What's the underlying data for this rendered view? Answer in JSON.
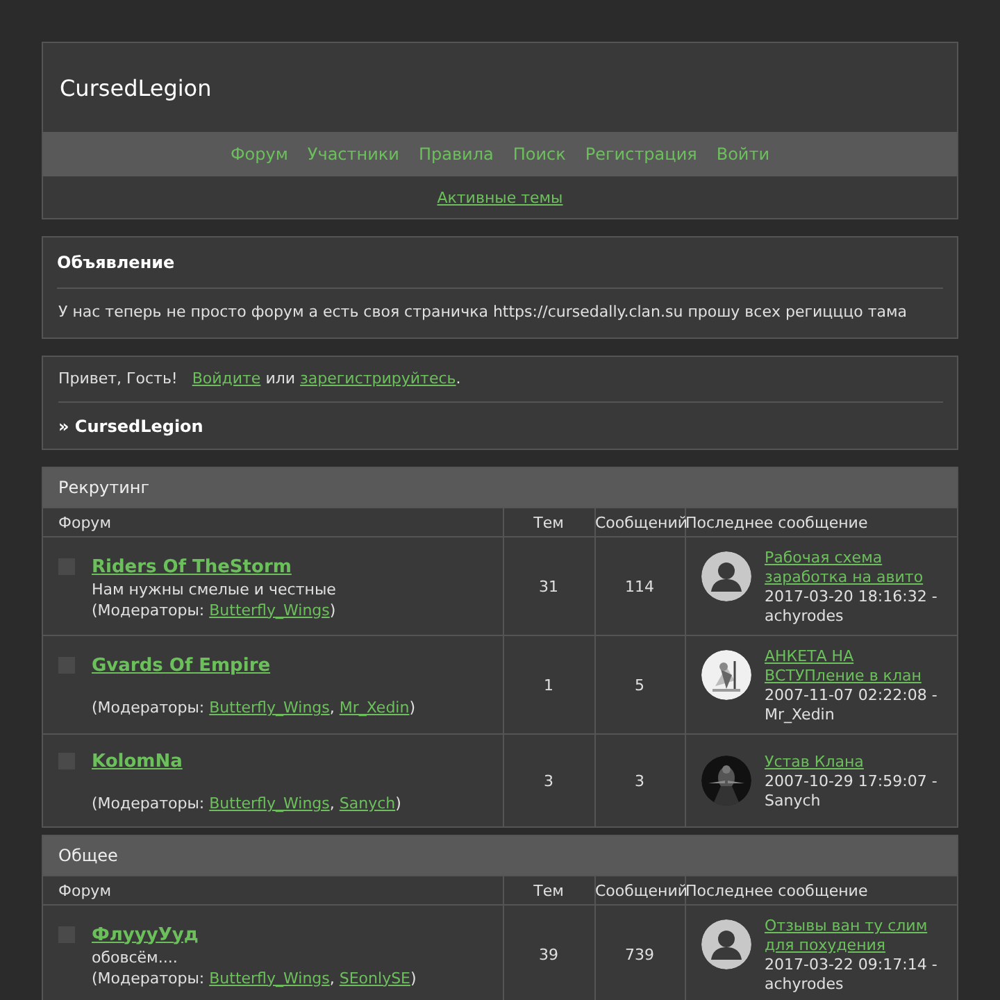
{
  "header": {
    "title": "CursedLegion",
    "nav": [
      "Форум",
      "Участники",
      "Правила",
      "Поиск",
      "Регистрация",
      "Войти"
    ],
    "active_topics_link": "Активные темы"
  },
  "announcement": {
    "title": "Объявление",
    "text": "У нас теперь не просто форум а есть своя страничка https://cursedally.clan.su прошу всех регицццо тама"
  },
  "welcome": {
    "greeting": "Привет, Гость!",
    "login_link": "Войдите",
    "conjunction": "или",
    "register_link": "зарегистрируйтесь",
    "end": ".",
    "breadcrumb": "» CursedLegion"
  },
  "categories": [
    {
      "title": "Рекрутинг",
      "columns": [
        "Форум",
        "Тем",
        "Сообщений",
        "Последнее сообщение"
      ],
      "forums": [
        {
          "name": "Riders Of TheStorm",
          "description": "Нам нужны смелые и честные",
          "moderators_prefix": "(Модераторы: ",
          "moderators": [
            "Butterfly_Wings"
          ],
          "moderators_suffix": ")",
          "topics": "31",
          "posts": "114",
          "last_post": {
            "avatar": {
              "kind": "default"
            },
            "topic": "Рабочая схема заработка на авито",
            "date": "2017-03-20 18:16:32 -",
            "author": "achyrodes"
          }
        },
        {
          "name": "Gvards Of Empire",
          "moderators_prefix": "(Модераторы: ",
          "moderators": [
            "Butterfly_Wings",
            "Mr_Xedin"
          ],
          "separator": ", ",
          "moderators_suffix": ")",
          "topics": "1",
          "posts": "5",
          "last_post": {
            "topic": "АНКЕТА НА ВСТУПление в клан",
            "date": "2007-11-07 02:22:08 -",
            "author": "Mr_Xedin"
          }
        },
        {
          "name": "KolomNa",
          "moderators_prefix": "(Модераторы: ",
          "moderators": [
            "Butterfly_Wings",
            "Sanych"
          ],
          "separator": ", ",
          "moderators_suffix": ")",
          "topics": "3",
          "posts": "3",
          "last_post": {
            "topic": "Устав Клана",
            "date": "2007-10-29 17:59:07 -",
            "author": "Sanych"
          }
        }
      ]
    },
    {
      "title": "Общее",
      "columns": [
        "Форум",
        "Тем",
        "Сообщений",
        "Последнее сообщение"
      ],
      "forums": [
        {
          "name": "ФлуууУуд",
          "description": "обовсём....",
          "moderators_prefix": "(Модераторы: ",
          "moderators": [
            "Butterfly_Wings",
            "SEonlySE"
          ],
          "separator": ", ",
          "moderators_suffix": ")",
          "topics": "39",
          "posts": "739",
          "last_post": {
            "avatar": {
              "kind": "default"
            },
            "topic": "Отзывы ван ту слим для похудения",
            "date": "2017-03-22 09:17:14 -",
            "author": "achyrodes"
          }
        }
      ]
    }
  ]
}
